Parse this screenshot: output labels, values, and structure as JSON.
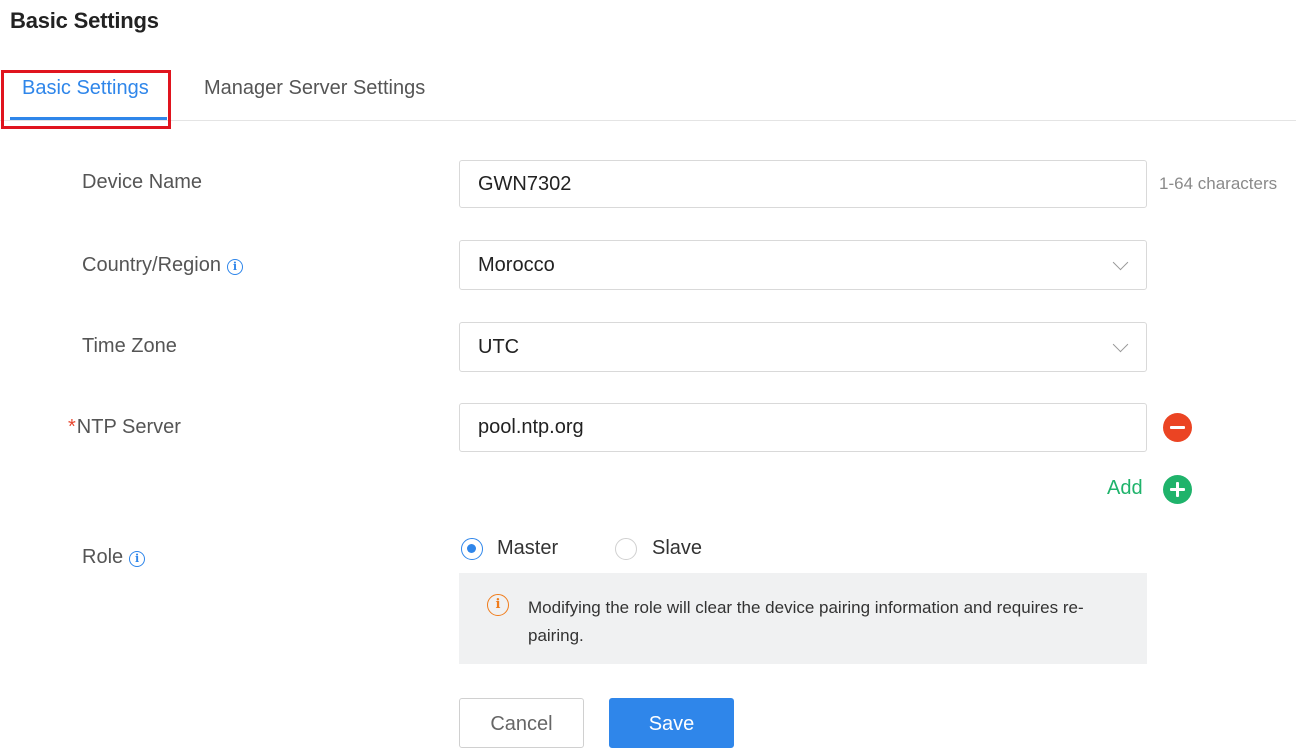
{
  "page": {
    "title": "Basic Settings"
  },
  "tabs": [
    {
      "label": "Basic Settings",
      "active": true
    },
    {
      "label": "Manager Server Settings",
      "active": false
    }
  ],
  "form": {
    "device_name": {
      "label": "Device Name",
      "value": "GWN7302",
      "hint": "1-64 characters"
    },
    "country": {
      "label": "Country/Region",
      "value": "Morocco"
    },
    "timezone": {
      "label": "Time Zone",
      "value": "UTC"
    },
    "ntp": {
      "required_mark": "*",
      "label": "NTP Server",
      "value": "pool.ntp.org",
      "add_label": "Add"
    },
    "role": {
      "label": "Role",
      "options": [
        "Master",
        "Slave"
      ],
      "selected": "Master",
      "notice": "Modifying the role will clear the device pairing information and requires re-pairing."
    }
  },
  "actions": {
    "cancel_label": "Cancel",
    "save_label": "Save"
  },
  "colors": {
    "accent": "#2f86ea",
    "danger": "#eb4423",
    "success": "#1fb36b",
    "warning": "#f07c1b",
    "highlight": "#e0141e"
  }
}
